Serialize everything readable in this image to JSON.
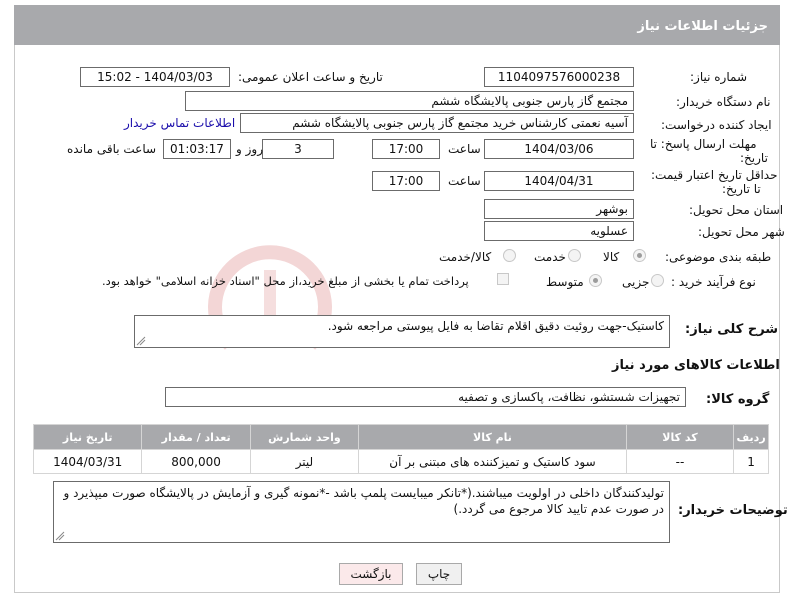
{
  "page": {
    "title": "جزئیات اطلاعات نیاز"
  },
  "form": {
    "need_number_label": "شماره نیاز:",
    "need_number": "1104097576000238",
    "announce_label": "تاریخ و ساعت اعلان عمومی:",
    "announce_value": "1404/03/03 - 15:02",
    "buyer_org_label": "نام دستگاه خریدار:",
    "buyer_org": "مجتمع گاز پارس جنوبی  پالایشگاه ششم",
    "requester_label": "ایجاد کننده درخواست:",
    "requester": "آسیه نعمتی کارشناس خرید مجتمع گاز پارس جنوبی  پالایشگاه ششم",
    "contact_link": "اطلاعات تماس خریدار",
    "deadline_label_1": "مهلت ارسال پاسخ: تا",
    "deadline_label_2": "تاریخ:",
    "deadline_date": "1404/03/06",
    "time_label": "ساعت",
    "deadline_time": "17:00",
    "days_value": "3",
    "days_label": "روز و",
    "remaining_time": "01:03:17",
    "remaining_label": "ساعت باقی مانده",
    "min_validity_label_1": "حداقل تاریخ اعتبار قیمت:",
    "min_validity_label_2": "تا تاریخ:",
    "validity_date": "1404/04/31",
    "validity_time": "17:00",
    "province_label": "استان محل تحویل:",
    "province": "بوشهر",
    "city_label": "شهر محل تحویل:",
    "city": "عسلویه",
    "category_label": "طبقه بندی موضوعی:",
    "category_options": [
      "کالا",
      "خدمت",
      "کالا/خدمت"
    ],
    "process_label": "نوع فرآیند خرید :",
    "process_options": [
      "جزیی",
      "متوسط"
    ],
    "payment_note": "پرداخت تمام یا بخشی از مبلغ خرید،از محل \"اسناد خزانه اسلامی\" خواهد بود.",
    "description_label": "شرح کلی نیاز:",
    "description": "کاستیک-جهت روئیت دقیق اقلام تقاضا به فایل پیوستی مراجعه شود.",
    "goods_info_title": "اطلاعات کالاهای مورد نیاز",
    "goods_group_label": "گروه کالا:",
    "goods_group": "تجهیزات شستشو، نظافت، پاکسازی و تصفیه",
    "buyer_notes_label": "توضیحات خریدار:",
    "buyer_notes": "تولیدکنندگان داخلی در اولویت میباشند.(*تانکر میبایست پلمپ باشد -*نمونه گیری و آزمایش در پالایشگاه صورت میپذیرد و در صورت عدم تایید کالا مرجوع می گردد.)"
  },
  "table": {
    "headers": [
      "ردیف",
      "کد کالا",
      "نام کالا",
      "واحد شمارش",
      "تعداد / مقدار",
      "تاریخ نیاز"
    ],
    "rows": [
      [
        "1",
        "--",
        "سود کاستیک و تمیزکننده های مبتنی بر آن",
        "لیتر",
        "800,000",
        "1404/03/31"
      ]
    ]
  },
  "buttons": {
    "print": "چاپ",
    "back": "بازگشت"
  },
  "colors": {
    "header_bg": "#a8a9ac",
    "link": "#1a0dab",
    "back_button_bg": "#fbe9ea"
  }
}
